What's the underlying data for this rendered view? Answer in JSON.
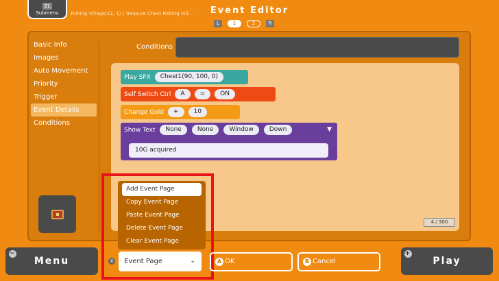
{
  "header": {
    "submenu_key": "ZL",
    "submenu_label": "Submenu",
    "breadcrumb": "Fishing Village(12, 1) / Treasure Chest Fishing Vill…",
    "title": "Event Editor",
    "pager": {
      "left_key": "L",
      "right_key": "R",
      "pages": [
        "1",
        "2"
      ],
      "active_page": "1"
    }
  },
  "sidebar": {
    "items": [
      "Basic Info",
      "Images",
      "Auto Movement",
      "Priority",
      "Trigger",
      "Event Details",
      "Conditions"
    ],
    "active": "Event Details"
  },
  "conditions": {
    "label": "Conditions",
    "value": ""
  },
  "commands": {
    "play_sfx": {
      "label": "Play SFX",
      "value": "Chest1(90, 100, 0)",
      "color": "#3aa8a0"
    },
    "self_switch": {
      "label": "Self Switch Ctrl",
      "switch": "A",
      "op": "=",
      "state": "ON",
      "color": "#f04a14"
    },
    "change_gold": {
      "label": "Change Gold",
      "op": "+",
      "amount": "10",
      "color": "#f49a14"
    },
    "show_text": {
      "label": "Show Text",
      "params": [
        "None",
        "None",
        "Window",
        "Down"
      ],
      "arrow": "▼",
      "text": "10G acquired",
      "color": "#6a3e9c"
    }
  },
  "counter": "4   / 300",
  "popup_menu": {
    "items": [
      "Add Event Page",
      "Copy Event Page",
      "Paste Event Page",
      "Delete Event Page",
      "Clear Event Page"
    ],
    "highlighted": "Add Event Page"
  },
  "footer": {
    "menu_key": "−",
    "menu_label": "Menu",
    "x_key": "X",
    "select_value": "Event Page",
    "select_chevron": "⌄",
    "ok_key": "A",
    "ok_label": "OK",
    "cancel_key": "B",
    "cancel_label": "Cancel",
    "play_key": "+",
    "play_label": "Play"
  }
}
